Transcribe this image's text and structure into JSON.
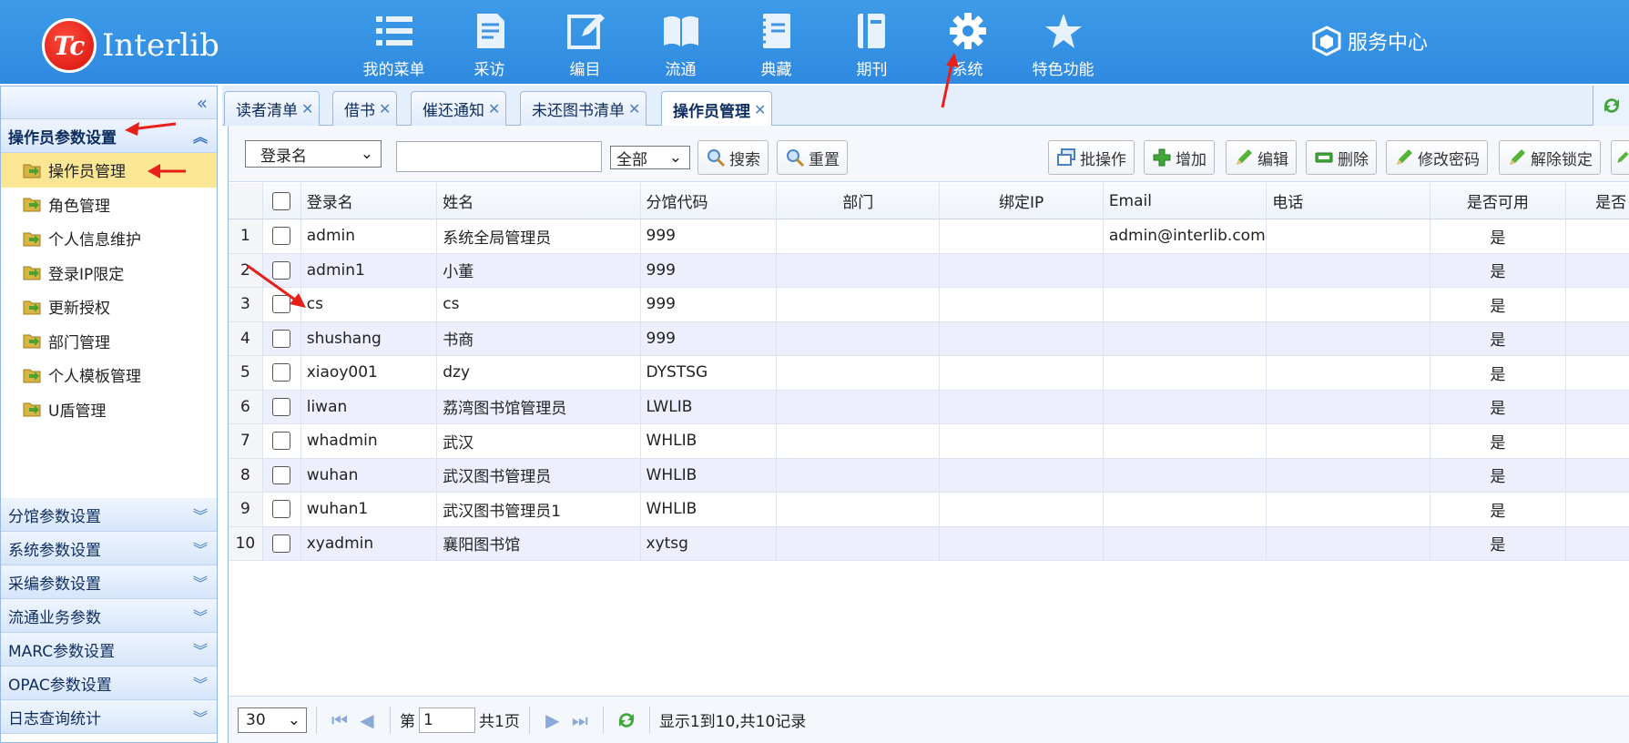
{
  "header": {
    "logo_mark": "Tc",
    "logo_text": "Interlib",
    "nav": [
      {
        "label": "我的菜单",
        "icon": "list-icon"
      },
      {
        "label": "采访",
        "icon": "document-icon"
      },
      {
        "label": "编目",
        "icon": "edit-icon"
      },
      {
        "label": "流通",
        "icon": "book-open-icon"
      },
      {
        "label": "典藏",
        "icon": "notebook-icon"
      },
      {
        "label": "期刊",
        "icon": "journal-icon"
      },
      {
        "label": "系统",
        "icon": "gear-icon"
      },
      {
        "label": "特色功能",
        "icon": "star-icon"
      }
    ],
    "service_label": "服务中心"
  },
  "sidebar": {
    "active_panel": "操作员参数设置",
    "menu_items": [
      "操作员管理",
      "角色管理",
      "个人信息维护",
      "登录IP限定",
      "更新授权",
      "部门管理",
      "个人模板管理",
      "U盾管理"
    ],
    "selected_index": 0,
    "panels": [
      "分馆参数设置",
      "系统参数设置",
      "采编参数设置",
      "流通业务参数",
      "MARC参数设置",
      "OPAC参数设置",
      "日志查询统计"
    ]
  },
  "tabs": [
    "读者清单",
    "借书",
    "催还通知",
    "未还图书清单",
    "操作员管理"
  ],
  "toolbar": {
    "field_select": "登录名",
    "search_value": "",
    "scope_select": "全部",
    "search_label": "搜索",
    "reset_label": "重置",
    "batch_label": "批操作",
    "add_label": "增加",
    "edit_label": "编辑",
    "delete_label": "删除",
    "change_pwd_label": "修改密码",
    "unlock_label": "解除锁定"
  },
  "table": {
    "headers": {
      "login": "登录名",
      "name": "姓名",
      "code": "分馆代码",
      "dept": "部门",
      "ip": "绑定IP",
      "email": "Email",
      "phone": "电话",
      "avail": "是否可用",
      "more": "是否"
    },
    "rows": [
      {
        "num": "1",
        "login": "admin",
        "name": "系统全局管理员",
        "code": "999",
        "dept": "",
        "ip": "",
        "email": "admin@interlib.com",
        "phone": "",
        "avail": "是"
      },
      {
        "num": "2",
        "login": "admin1",
        "name": "小董",
        "code": "999",
        "dept": "",
        "ip": "",
        "email": "",
        "phone": "",
        "avail": "是"
      },
      {
        "num": "3",
        "login": "cs",
        "name": "cs",
        "code": "999",
        "dept": "",
        "ip": "",
        "email": "",
        "phone": "",
        "avail": "是"
      },
      {
        "num": "4",
        "login": "shushang",
        "name": "书商",
        "code": "999",
        "dept": "",
        "ip": "",
        "email": "",
        "phone": "",
        "avail": "是"
      },
      {
        "num": "5",
        "login": "xiaoy001",
        "name": "dzy",
        "code": "DYSTSG",
        "dept": "",
        "ip": "",
        "email": "",
        "phone": "",
        "avail": "是"
      },
      {
        "num": "6",
        "login": "liwan",
        "name": "荔湾图书馆管理员",
        "code": "LWLIB",
        "dept": "",
        "ip": "",
        "email": "",
        "phone": "",
        "avail": "是"
      },
      {
        "num": "7",
        "login": "whadmin",
        "name": "武汉",
        "code": "WHLIB",
        "dept": "",
        "ip": "",
        "email": "",
        "phone": "",
        "avail": "是"
      },
      {
        "num": "8",
        "login": "wuhan",
        "name": "武汉图书管理员",
        "code": "WHLIB",
        "dept": "",
        "ip": "",
        "email": "",
        "phone": "",
        "avail": "是"
      },
      {
        "num": "9",
        "login": "wuhan1",
        "name": "武汉图书管理员1",
        "code": "WHLIB",
        "dept": "",
        "ip": "",
        "email": "",
        "phone": "",
        "avail": "是"
      },
      {
        "num": "10",
        "login": "xyadmin",
        "name": "襄阳图书馆",
        "code": "xytsg",
        "dept": "",
        "ip": "",
        "email": "",
        "phone": "",
        "avail": "是"
      }
    ]
  },
  "pager": {
    "page_size": "30",
    "page_prefix": "第",
    "page_value": "1",
    "page_total": "共1页",
    "summary": "显示1到10,共10记录"
  },
  "colors": {
    "header_blue": "#2f8ae0",
    "selected_yellow": "#fbe694",
    "annotation_red": "#e8201a"
  }
}
